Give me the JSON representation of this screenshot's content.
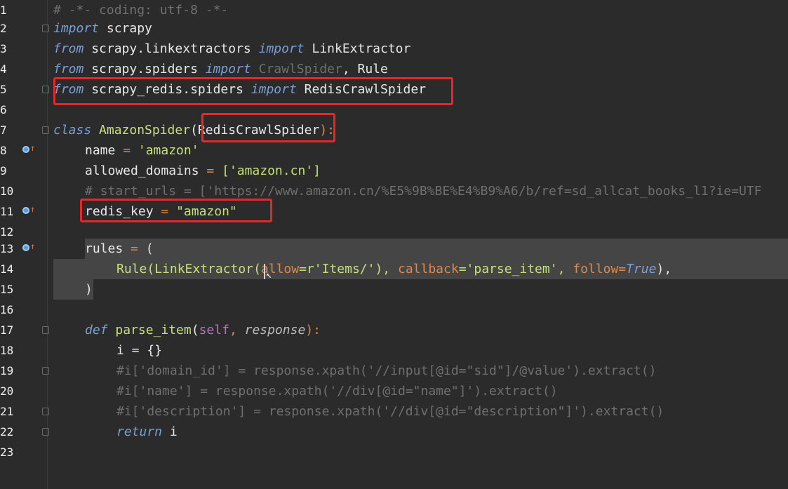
{
  "editor": {
    "lines": [
      {
        "n": "1",
        "text": "# -*- coding: utf-8 -*-"
      },
      {
        "n": "2",
        "kw": "import",
        "rest": " scrapy"
      },
      {
        "n": "3",
        "kw1": "from",
        "mod": " scrapy.linkextractors ",
        "kw2": "import",
        "rest": " LinkExtractor"
      },
      {
        "n": "4",
        "kw1": "from",
        "mod": " scrapy.spiders ",
        "kw2": "import",
        "dim": " CrawlSpider",
        "rest": ", Rule"
      },
      {
        "n": "5",
        "kw1": "from",
        "mod": " scrapy_redis.spiders ",
        "kw2": "import",
        "rest": " RedisCrawlSpider"
      },
      {
        "n": "6"
      },
      {
        "n": "7",
        "kw": "class",
        "name": " AmazonSpider",
        "open": "(",
        "base": "RedisCrawlSpider",
        "close": "):"
      },
      {
        "n": "8",
        "var": "name",
        "eq": " = ",
        "val": "'amazon'"
      },
      {
        "n": "9",
        "var": "allowed_domains",
        "eq": " = ",
        "val": "['amazon.cn']"
      },
      {
        "n": "10",
        "comment": "# start_urls = ['https://www.amazon.cn/%E5%9B%BE%E4%B9%A6/b/ref=sd_allcat_books_l1?ie=UTF"
      },
      {
        "n": "11",
        "var": "redis_key",
        "eq": " = ",
        "val": "\"amazon\""
      },
      {
        "n": "12"
      },
      {
        "n": "13",
        "var": "rules",
        "eq": " = ",
        "val": "("
      },
      {
        "n": "14",
        "p1": "Rule(LinkExtractor(",
        "p2": "allow",
        "p3": "=r'Items/'), ",
        "p4": "callback",
        "p5": "='parse_item', ",
        "p6": "follow",
        "p7": "=",
        "p8": "True",
        "p9": "),"
      },
      {
        "n": "15",
        "val": ")"
      },
      {
        "n": "16"
      },
      {
        "n": "17",
        "kw": "def",
        "fn": " parse_item",
        "open": "(",
        "self": "self",
        ", ": ", ",
        "resp": "response",
        "close": "):"
      },
      {
        "n": "18",
        "val": "i = {}"
      },
      {
        "n": "19",
        "comment": "#i['domain_id'] = response.xpath('//input[@id=\"sid\"]/@value').extract()"
      },
      {
        "n": "20",
        "comment": "#i['name'] = response.xpath('//div[@id=\"name\"]').extract()"
      },
      {
        "n": "21",
        "comment": "#i['description'] = response.xpath('//div[@id=\"description\"]').extract()"
      },
      {
        "n": "22",
        "kw": "return",
        "rest": " i"
      },
      {
        "n": "23"
      }
    ]
  }
}
